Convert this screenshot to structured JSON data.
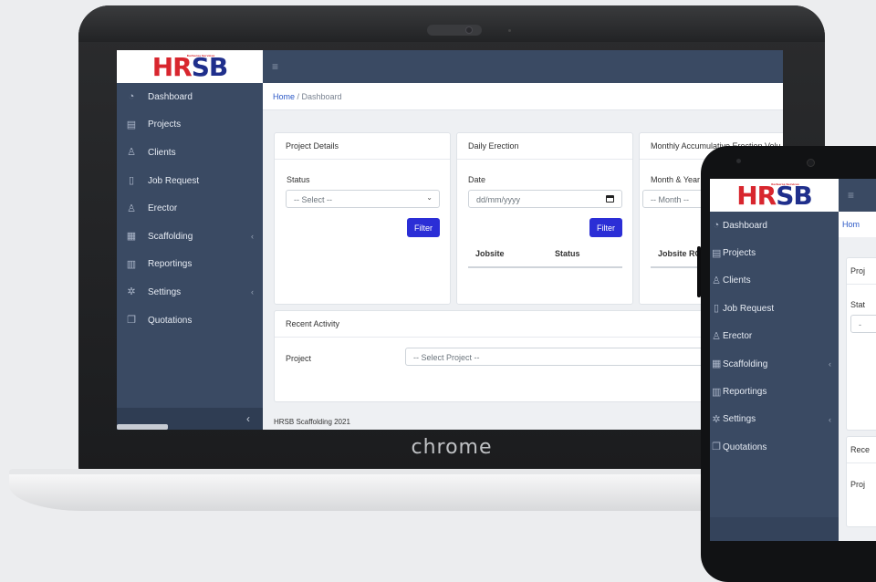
{
  "device_label": "chrome",
  "brand": {
    "logo_hr": "HR",
    "logo_sb": "SB",
    "logo_tagline": "Kerberos Services"
  },
  "sidebar": {
    "items": [
      {
        "label": "Dashboard",
        "icon": "dashboard-icon",
        "glyph": "◔"
      },
      {
        "label": "Projects",
        "icon": "document-icon",
        "glyph": "▤"
      },
      {
        "label": "Clients",
        "icon": "user-icon",
        "glyph": "♙"
      },
      {
        "label": "Job Request",
        "icon": "file-icon",
        "glyph": "▯"
      },
      {
        "label": "Erector",
        "icon": "users-icon",
        "glyph": "♙"
      },
      {
        "label": "Scaffolding",
        "icon": "building-icon",
        "glyph": "▦",
        "chevron": "‹"
      },
      {
        "label": "Reportings",
        "icon": "bar-chart-icon",
        "glyph": "▥"
      },
      {
        "label": "Settings",
        "icon": "gear-icon",
        "glyph": "✲",
        "chevron": "‹"
      },
      {
        "label": "Quotations",
        "icon": "copy-icon",
        "glyph": "❐"
      }
    ],
    "collapse_glyph": "‹"
  },
  "topbar": {
    "menu_glyph": "≡"
  },
  "breadcrumb": {
    "home": "Home",
    "separator": " / ",
    "current": "Dashboard",
    "home_cut": "Hom"
  },
  "project_details": {
    "title": "Project Details",
    "status_label": "Status",
    "status_value": "-- Select --",
    "filter_label": "Filter"
  },
  "daily_erection": {
    "title": "Daily Erection",
    "date_label": "Date",
    "date_placeholder": "dd/mm/yyyy",
    "filter_label": "Filter",
    "columns": [
      "Jobsite",
      "Status"
    ]
  },
  "monthly_erection": {
    "title": "Monthly Accumulative Erection Volu",
    "month_label": "Month & Year",
    "month_value": "-- Month --",
    "columns": [
      "Jobsite RO"
    ]
  },
  "recent_activity": {
    "title": "Recent Activity",
    "project_label": "Project",
    "project_value": "-- Select Project --"
  },
  "footer": {
    "text": "HRSB Scaffolding 2021"
  },
  "phone": {
    "card_title_cut": "Proj",
    "status_cut": "Stat",
    "select_cut": "-",
    "recent_cut": "Rece",
    "project_cut": "Proj"
  },
  "colors": {
    "sidebar": "#3a4a63",
    "accent": "#2b2ed6",
    "logo_red": "#d8262e",
    "logo_blue": "#1f2f8c"
  }
}
